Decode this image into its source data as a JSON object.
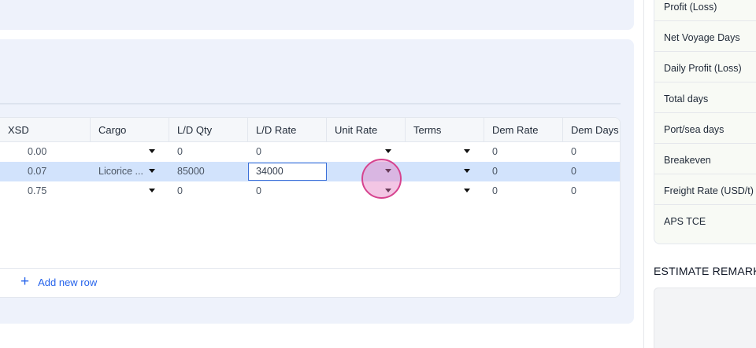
{
  "table": {
    "columns": [
      "XSD",
      "Cargo",
      "L/D Qty",
      "L/D Rate",
      "Unit Rate",
      "Terms",
      "Dem Rate",
      "Dem Days"
    ],
    "rows": [
      {
        "xsd": "0.00",
        "cargo": "",
        "ld_qty": "0",
        "ld_rate": "0",
        "unit_rate": "",
        "terms": "",
        "dem_rate": "0",
        "dem_days": "0"
      },
      {
        "xsd": "0.07",
        "cargo": "Licorice ...",
        "ld_qty": "85000",
        "ld_rate": "34000",
        "unit_rate": "",
        "terms": "",
        "dem_rate": "0",
        "dem_days": "0"
      },
      {
        "xsd": "0.75",
        "cargo": "",
        "ld_qty": "0",
        "ld_rate": "0",
        "unit_rate": "",
        "terms": "",
        "dem_rate": "0",
        "dem_days": "0"
      }
    ],
    "add_row_label": "Add new row"
  },
  "summary": {
    "items": [
      "Profit (Loss)",
      "Net Voyage Days",
      "Daily Profit (Loss)",
      "Total days",
      "Port/sea days",
      "Breakeven",
      "Freight Rate (USD/t)",
      "APS TCE"
    ]
  },
  "remarks": {
    "title": "ESTIMATE REMARK"
  },
  "colors": {
    "panel_bg": "#eef2fb",
    "selected_row": "#d2e3fc",
    "accent": "#2563eb",
    "cursor_ring": "#d6438e"
  },
  "icons": {
    "add": "plus-icon",
    "dropdown": "caret-down-icon"
  }
}
